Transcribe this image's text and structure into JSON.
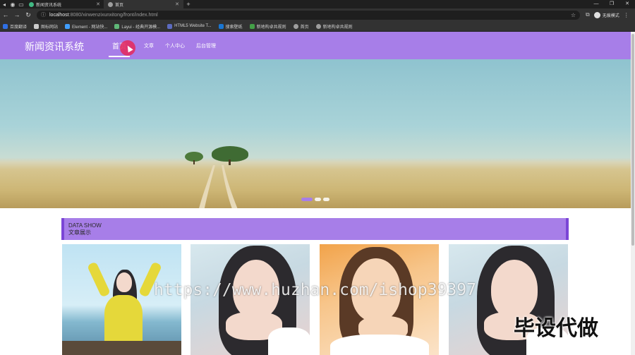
{
  "browser": {
    "tabs": [
      {
        "title": "新闻资讯系统",
        "active": false,
        "favicon_color": "#41b883"
      },
      {
        "title": "首页",
        "active": true,
        "favicon_color": "#9e9e9e"
      }
    ],
    "new_tab_label": "+",
    "address": {
      "url_host": "localhost",
      "url_rest": ":8080/xinwenzixunxitong/front/index.html"
    },
    "profile_label": "无痕模式",
    "bookmarks": [
      {
        "label": "百度翻译",
        "color": "#2f6fe4"
      },
      {
        "label": "图标网站",
        "color": "#222222"
      },
      {
        "label": "Element - 网站快...",
        "color": "#409eff"
      },
      {
        "label": "Layui - 经典开源模...",
        "color": "#5fb878"
      },
      {
        "label": "HTML5 Website T...",
        "color": "#5c6bc0"
      },
      {
        "label": "搜索壁纸",
        "color": "#1976d2"
      },
      {
        "label": "新地构卓共规则",
        "color": "#43a047"
      },
      {
        "label": "首页",
        "color": "#9e9e9e"
      },
      {
        "label": "新地构卓共规则",
        "color": "#9e9e9e"
      }
    ]
  },
  "site": {
    "brand": "新闻资讯系统",
    "nav": [
      {
        "label": "首页",
        "active": true
      },
      {
        "label": "文章",
        "active": false
      },
      {
        "label": "个人中心",
        "active": false
      },
      {
        "label": "后台管理",
        "active": false
      }
    ],
    "theme_color": "#a77ee8",
    "accent_color": "#7b46d6"
  },
  "banner": {
    "slide_count": 3,
    "active_slide": 1
  },
  "section": {
    "title_en": "DATA SHOW",
    "title_cn": "文章展示"
  },
  "articles": [
    {
      "name": "article-card-1"
    },
    {
      "name": "article-card-2"
    },
    {
      "name": "article-card-3"
    },
    {
      "name": "article-card-4"
    }
  ],
  "watermark": {
    "url_text": "https://www.huzhan.com/ishop39397",
    "badge_text": "毕设代做"
  }
}
